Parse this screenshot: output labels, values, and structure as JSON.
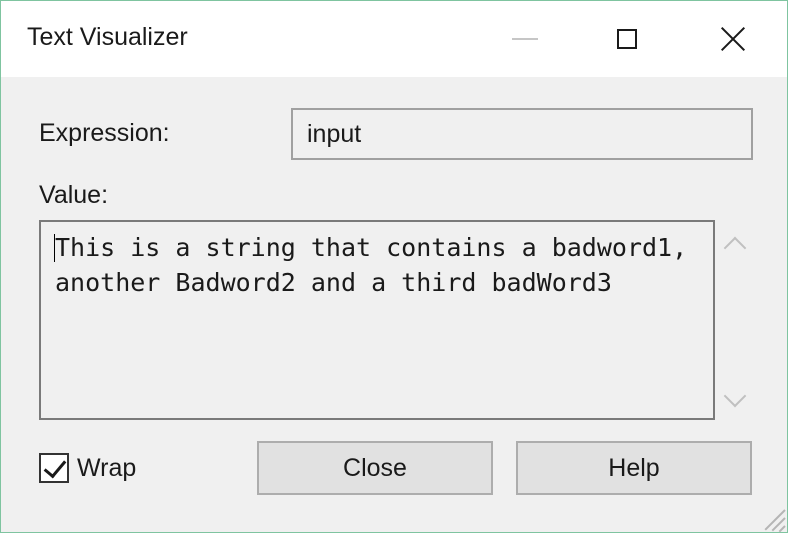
{
  "window": {
    "title": "Text Visualizer"
  },
  "titlebar_buttons": {
    "minimize": "minimize-icon",
    "maximize": "maximize-icon",
    "close": "close-icon"
  },
  "expression": {
    "label": "Expression:",
    "value": "input"
  },
  "value": {
    "label": "Value:",
    "text": "This is a string that contains a badword1, another Badword2 and a third badWord3"
  },
  "wrap": {
    "label": "Wrap",
    "checked": true
  },
  "buttons": {
    "close_label": "Close",
    "help_label": "Help"
  }
}
